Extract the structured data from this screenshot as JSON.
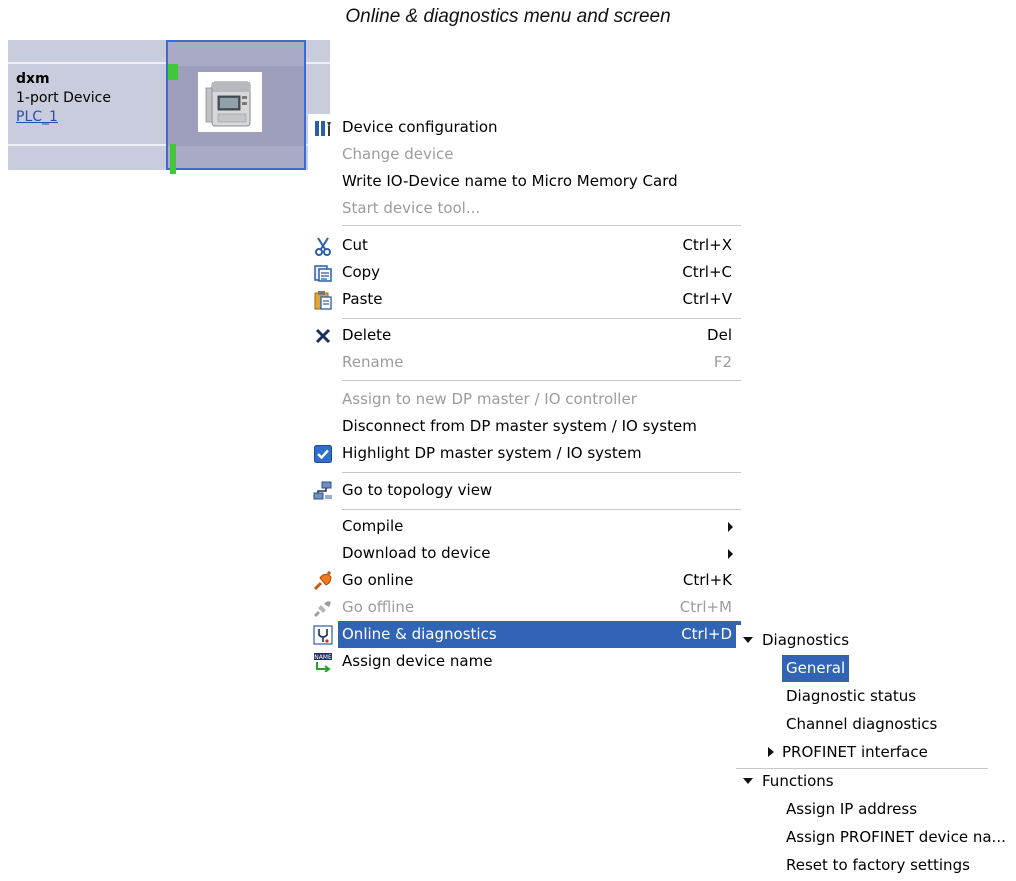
{
  "caption": "Online & diagnostics menu and screen",
  "device": {
    "name": "dxm",
    "type": "1-port Device",
    "plc": "PLC_1"
  },
  "context_menu": {
    "items": [
      {
        "label": "Device configuration",
        "shortcut": "",
        "icon": "device-configuration-icon",
        "enabled": true
      },
      {
        "label": "Change device",
        "shortcut": "",
        "icon": "",
        "enabled": false
      },
      {
        "label": "Write IO-Device name to Micro Memory Card",
        "shortcut": "",
        "icon": "",
        "enabled": true
      },
      {
        "label": "Start device tool...",
        "shortcut": "",
        "icon": "",
        "enabled": false
      },
      {
        "label": "Cut",
        "shortcut": "Ctrl+X",
        "icon": "scissors-icon",
        "enabled": true
      },
      {
        "label": "Copy",
        "shortcut": "Ctrl+C",
        "icon": "copy-icon",
        "enabled": true
      },
      {
        "label": "Paste",
        "shortcut": "Ctrl+V",
        "icon": "paste-icon",
        "enabled": true
      },
      {
        "label": "Delete",
        "shortcut": "Del",
        "icon": "delete-icon",
        "enabled": true
      },
      {
        "label": "Rename",
        "shortcut": "F2",
        "icon": "",
        "enabled": false
      },
      {
        "label": "Assign to new DP master / IO controller",
        "shortcut": "",
        "icon": "",
        "enabled": false
      },
      {
        "label": "Disconnect from DP master system / IO system",
        "shortcut": "",
        "icon": "",
        "enabled": true
      },
      {
        "label": "Highlight DP master system / IO system",
        "shortcut": "",
        "icon": "checkbox-checked-icon",
        "enabled": true
      },
      {
        "label": "Go to topology view",
        "shortcut": "",
        "icon": "topology-icon",
        "enabled": true
      },
      {
        "label": "Compile",
        "shortcut": "",
        "icon": "",
        "enabled": true,
        "submenu": true
      },
      {
        "label": "Download to device",
        "shortcut": "",
        "icon": "",
        "enabled": true,
        "submenu": true
      },
      {
        "label": "Go online",
        "shortcut": "Ctrl+K",
        "icon": "go-online-icon",
        "enabled": true
      },
      {
        "label": "Go offline",
        "shortcut": "Ctrl+M",
        "icon": "go-offline-icon",
        "enabled": false
      },
      {
        "label": "Online & diagnostics",
        "shortcut": "Ctrl+D",
        "icon": "online-diagnostics-icon",
        "enabled": true,
        "selected": true
      },
      {
        "label": "Assign device name",
        "shortcut": "",
        "icon": "assign-name-icon",
        "enabled": true
      }
    ]
  },
  "submenu": {
    "diagnostics_header": "Diagnostics",
    "general": "General",
    "diagnostic_status": "Diagnostic status",
    "channel_diagnostics": "Channel diagnostics",
    "profinet_interface": "PROFINET interface",
    "functions_header": "Functions",
    "assign_ip": "Assign IP address",
    "assign_profinet_name": "Assign PROFINET device na...",
    "reset_factory": "Reset to factory settings"
  },
  "colors": {
    "selection": "#3164b5",
    "canvas": "#c9ccdc",
    "device_border": "#3c6ad1",
    "disabled_text": "#9c9c9c",
    "status_green": "#43c63a"
  }
}
